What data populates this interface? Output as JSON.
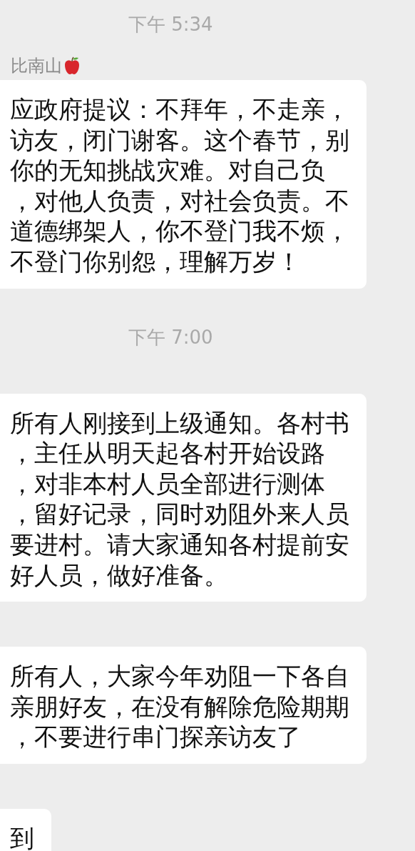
{
  "items": [
    {
      "kind": "time",
      "text": "下午 5:34"
    },
    {
      "kind": "message",
      "sender": "比南山",
      "lines": [
        "应政府提议：不拜年，不走亲，",
        "访友，闭门谢客。这个春节，别",
        "你的无知挑战灾难。对自己负",
        "，对他人负责，对社会负责。不",
        "道德绑架人，你不登门我不烦，",
        "不登门你别怨，理解万岁！"
      ]
    },
    {
      "kind": "time",
      "text": "下午 7:00"
    },
    {
      "kind": "message",
      "lines": [
        "所有人刚接到上级通知。各村书",
        "，主任从明天起各村开始设路",
        "，对非本村人员全部进行测体",
        "，留好记录，同时劝阻外来人员",
        "要进村。请大家通知各村提前安",
        "好人员，做好准备。"
      ]
    },
    {
      "kind": "message",
      "lines": [
        "所有人，大家今年劝阻一下各自",
        "亲朋好友，在没有解除危险期期",
        "，不要进行串门探亲访友了"
      ]
    },
    {
      "kind": "message",
      "lines": [
        "到"
      ]
    }
  ]
}
